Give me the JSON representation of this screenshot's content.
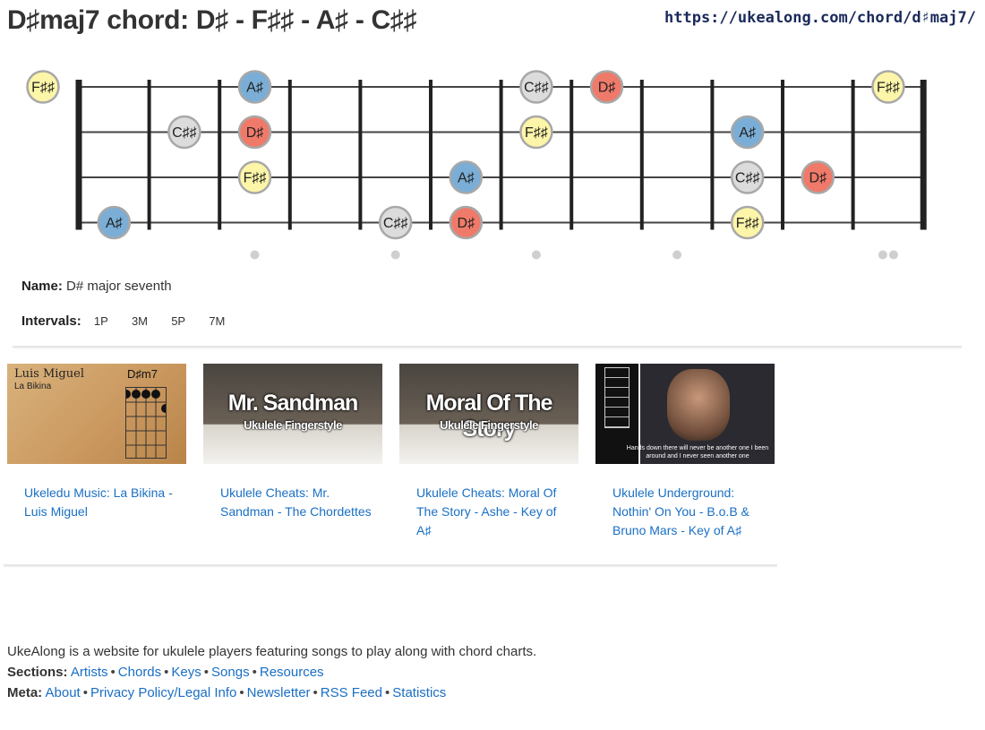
{
  "header": {
    "title": "D♯maj7 chord: D♯ - F♯♯ - A♯ - C♯♯",
    "url": "https://ukealong.com/chord/d♯maj7/"
  },
  "colors": {
    "root": "#f07a6a",
    "third": "#fdf5a8",
    "fifth": "#7aaed6",
    "seventh": "#dcdcdc",
    "link": "#1a6fc4"
  },
  "fretboard": {
    "strings": 4,
    "frets": 12,
    "inlay_frets": [
      3,
      5,
      7,
      9,
      12
    ],
    "notes": [
      {
        "string": 1,
        "fret": 0,
        "label": "F♯♯",
        "role": "third"
      },
      {
        "string": 1,
        "fret": 3,
        "label": "A♯",
        "role": "fifth"
      },
      {
        "string": 1,
        "fret": 7,
        "label": "C♯♯",
        "role": "seventh"
      },
      {
        "string": 1,
        "fret": 8,
        "label": "D♯",
        "role": "root"
      },
      {
        "string": 1,
        "fret": 12,
        "label": "F♯♯",
        "role": "third"
      },
      {
        "string": 2,
        "fret": 2,
        "label": "C♯♯",
        "role": "seventh"
      },
      {
        "string": 2,
        "fret": 3,
        "label": "D♯",
        "role": "root"
      },
      {
        "string": 2,
        "fret": 7,
        "label": "F♯♯",
        "role": "third"
      },
      {
        "string": 2,
        "fret": 10,
        "label": "A♯",
        "role": "fifth"
      },
      {
        "string": 3,
        "fret": 3,
        "label": "F♯♯",
        "role": "third"
      },
      {
        "string": 3,
        "fret": 6,
        "label": "A♯",
        "role": "fifth"
      },
      {
        "string": 3,
        "fret": 10,
        "label": "C♯♯",
        "role": "seventh"
      },
      {
        "string": 3,
        "fret": 11,
        "label": "D♯",
        "role": "root"
      },
      {
        "string": 4,
        "fret": 1,
        "label": "A♯",
        "role": "fifth"
      },
      {
        "string": 4,
        "fret": 5,
        "label": "C♯♯",
        "role": "seventh"
      },
      {
        "string": 4,
        "fret": 6,
        "label": "D♯",
        "role": "root"
      },
      {
        "string": 4,
        "fret": 10,
        "label": "F♯♯",
        "role": "third"
      }
    ]
  },
  "info": {
    "name_label": "Name:",
    "name_value": "D# major seventh",
    "intervals_label": "Intervals:",
    "intervals": [
      "1P",
      "3M",
      "5P",
      "7M"
    ]
  },
  "videos": [
    {
      "title": "Ukeledu Music: La Bikina - Luis Miguel",
      "thumb": {
        "heading": "Luis Miguel",
        "subheading": "La Bikina",
        "chord": "D♯m7"
      }
    },
    {
      "title": "Ukulele Cheats: Mr. Sandman - The Chordettes",
      "thumb": {
        "heading": "Mr. Sandman",
        "subheading": "Ukulele Fingerstyle"
      }
    },
    {
      "title": "Ukulele Cheats: Moral Of The Story - Ashe - Key of A♯",
      "thumb": {
        "heading": "Moral Of The Story",
        "subheading": "Ukulele Fingerstyle"
      }
    },
    {
      "title": "Ukulele Underground: Nothin' On You - B.o.B & Bruno Mars - Key of A♯",
      "thumb": {
        "caption": "Hands down there will never be another one I been around and I never seen another one"
      }
    }
  ],
  "footer": {
    "about_text": "UkeAlong is a website for ukulele players featuring songs to play along with chord charts.",
    "sections_label": "Sections:",
    "sections": [
      "Artists",
      "Chords",
      "Keys",
      "Songs",
      "Resources"
    ],
    "meta_label": "Meta:",
    "meta": [
      "About",
      "Privacy Policy/Legal Info",
      "Newsletter",
      "RSS Feed",
      "Statistics"
    ]
  }
}
